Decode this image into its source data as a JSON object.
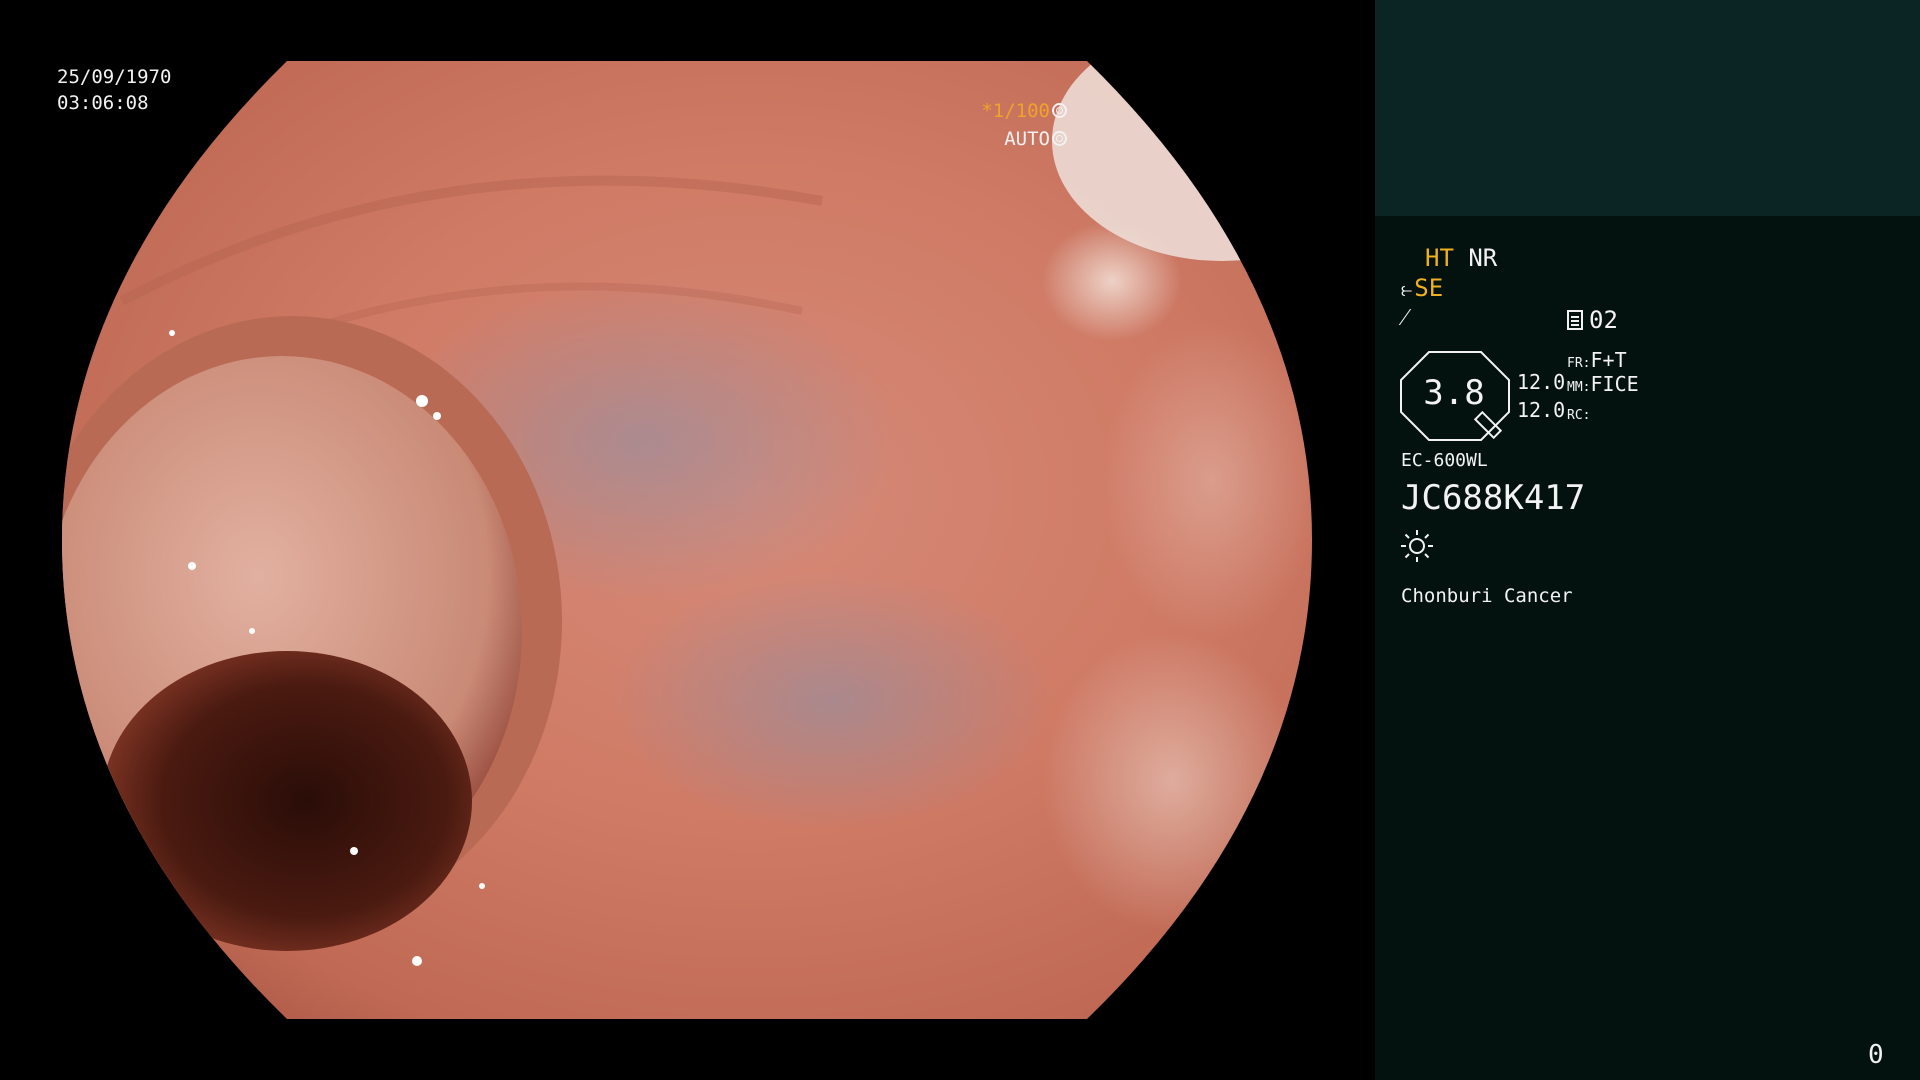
{
  "scope_view": {
    "date": "25/09/1970",
    "time": "03:06:08",
    "shutter": "*1/100",
    "exposure_mode": "AUTO"
  },
  "info_panel": {
    "ht_label": "HT",
    "nr_label": "NR",
    "se_label": "SE",
    "curve_symbol": "⁄",
    "doc_value": "02",
    "zoom_value": "3.8",
    "value_a": "12.0",
    "value_b": "12.0",
    "fr_label": "FR:",
    "fr_value": "F+T",
    "mm_label": "MM:",
    "mm_value": "FICE",
    "rc_label": "RC:",
    "rc_value": "",
    "scope_model": "EC-600WL",
    "serial_number": "JC688K417",
    "hospital": "Chonburi Cancer",
    "counter": "0"
  },
  "colors": {
    "panel_background": "#04120f",
    "panel_top_background": "#0b2424",
    "accent_yellow": "#f0b020",
    "accent_orange": "#f0a22a",
    "text": "#f2f2f2"
  },
  "icons": {
    "shutter": "aperture-icon",
    "auto": "ring-icon",
    "se": "scope-tip-icon",
    "curve": "curve-icon",
    "doc": "document-icon",
    "light": "light-sun-icon"
  }
}
